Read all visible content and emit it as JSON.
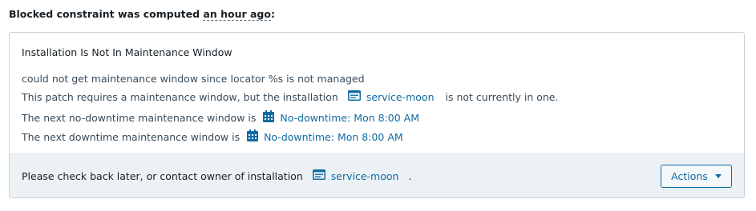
{
  "header": {
    "prefix": "Blocked constraint was computed ",
    "relative_time": "an hour ago",
    "suffix": ":"
  },
  "card": {
    "title": "Installation Is Not In Maintenance Window",
    "error_line": "could not get maintenance window since locator %s is not managed",
    "patch_line": {
      "before": "This patch requires a maintenance window, but the installation",
      "installation": "service-moon",
      "after": "is not currently in one."
    },
    "next_no_downtime": {
      "label": "The next no-downtime maintenance window is",
      "window": "No-downtime: Mon 8:00 AM"
    },
    "next_downtime": {
      "label": "The next downtime maintenance window is",
      "window": "No-downtime: Mon 8:00 AM"
    }
  },
  "footer": {
    "text": "Please check back later, or contact owner of installation",
    "installation": "service-moon",
    "period": ".",
    "actions_label": "Actions"
  },
  "colors": {
    "link": "#106ba3",
    "footer_bg": "#ebf1f5",
    "border": "#c9d2da"
  }
}
